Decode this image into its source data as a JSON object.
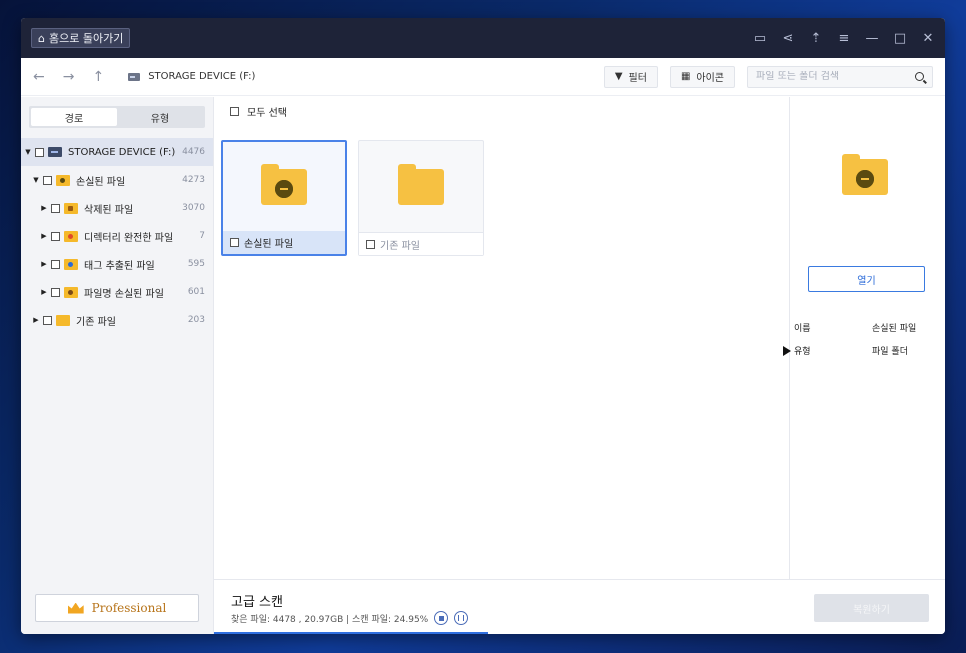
{
  "titlebar": {
    "home_label": "홈으로 돌아가기",
    "icons": [
      "feedback-icon",
      "share-icon",
      "upload-icon",
      "menu-icon",
      "minimize-icon",
      "maximize-icon",
      "close-icon"
    ]
  },
  "toolbar": {
    "path_label": "STORAGE DEVICE  (F:)",
    "filter_label": "필터",
    "view_label": "아이콘",
    "search_placeholder": "파일 또는 폴더 검색"
  },
  "sidebar": {
    "tabs": [
      {
        "label": "경로",
        "active": true
      },
      {
        "label": "유형",
        "active": false
      }
    ],
    "tree": [
      {
        "label": "STORAGE DEVICE  (F:)",
        "count": "4476",
        "icon": "drive-icon"
      },
      {
        "label": "손실된 파일",
        "count": "4273",
        "icon": "lost-folder-icon"
      },
      {
        "label": "삭제된 파일",
        "count": "3070",
        "icon": "deleted-folder-icon"
      },
      {
        "label": "디렉터리 완전한 파일",
        "count": "7",
        "icon": "directory-folder-icon"
      },
      {
        "label": "태그 추출된 파일",
        "count": "595",
        "icon": "tag-folder-icon"
      },
      {
        "label": "파일명 손실된 파일",
        "count": "601",
        "icon": "name-lost-folder-icon"
      },
      {
        "label": "기존 파일",
        "count": "203",
        "icon": "folder-icon"
      }
    ],
    "pro_label": "Professional"
  },
  "main": {
    "select_all_label": "모두 선택",
    "cards": [
      {
        "label": "손실된 파일",
        "selected": true
      },
      {
        "label": "기존 파일",
        "selected": false
      }
    ]
  },
  "panel": {
    "open_label": "열기",
    "props": [
      {
        "key": "이름",
        "value": "손실된 파일"
      },
      {
        "key": "유형",
        "value": "파일 폴더"
      }
    ]
  },
  "status": {
    "title": "고급 스캔",
    "info": "찾은 파일: 4478 , 20.97GB | 스캔 파일: 24.95%",
    "progress_percent": 24.95,
    "recover_label": "복원하기"
  },
  "colors": {
    "accent": "#2f6fe0",
    "folder": "#f6c142",
    "titlebar": "#1e2338",
    "pro_text": "#b7741a"
  }
}
